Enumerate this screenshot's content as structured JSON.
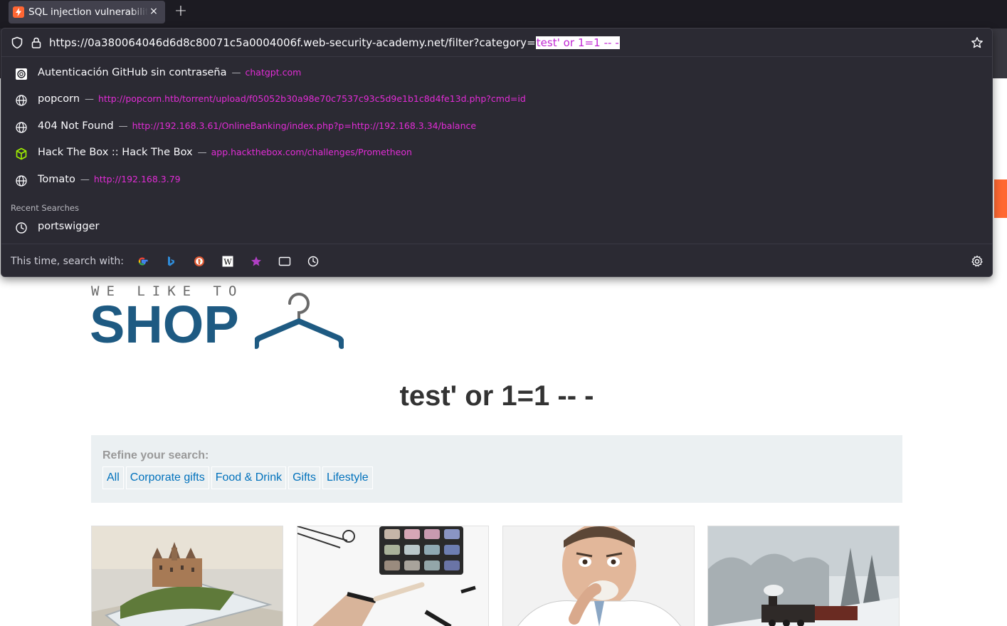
{
  "browser": {
    "tab": {
      "title": "SQL injection vulnerability in WHERE clause allowing retrieval of hidden data",
      "favicon": "portswigger-icon",
      "close_label": "×"
    },
    "new_tab_label": "+",
    "url": {
      "base": "https://0a380064046d6d8c80071c5a0004006f.web-security-academy.net/filter?category=",
      "selected": "test' or 1=1 -- -"
    },
    "suggestions": [
      {
        "title": "Autenticación GitHub sin contraseña",
        "sep": "—",
        "url": "chatgpt.com",
        "icon": "chatgpt-icon"
      },
      {
        "title": "popcorn",
        "sep": "—",
        "url": "http://popcorn.htb/torrent/upload/f05052b30a98e70c7537c93c5d9e1b1c8d4fe13d.php?cmd=id",
        "icon": "globe-icon"
      },
      {
        "title": "404 Not Found",
        "sep": "—",
        "url": "http://192.168.3.61/OnlineBanking/index.php?p=http://192.168.3.34/balance",
        "icon": "globe-icon"
      },
      {
        "title": "Hack The Box :: Hack The Box",
        "sep": "—",
        "url": "app.hackthebox.com/challenges/Prometheon",
        "icon": "hackthebox-icon"
      },
      {
        "title": "Tomato",
        "sep": "—",
        "url": "http://192.168.3.79",
        "icon": "globe-icon"
      }
    ],
    "recent_label": "Recent Searches",
    "recent": [
      {
        "title": "portswigger",
        "icon": "clock-icon"
      }
    ],
    "search_with_label": "This time, search with:",
    "engines": [
      "google-icon",
      "bing-icon",
      "duckduckgo-icon",
      "wikipedia-icon",
      "bookmarks-icon",
      "tabs-icon",
      "history-icon"
    ]
  },
  "page": {
    "logo": {
      "tagline": "WE LIKE TO",
      "name": "SHOP"
    },
    "heading": "test' or 1=1 -- -",
    "filter": {
      "label": "Refine your search:",
      "categories": [
        "All",
        "Corporate gifts",
        "Food & Drink",
        "Gifts",
        "Lifestyle"
      ]
    },
    "products": [
      "castle-phone-image",
      "makeup-image",
      "man-eating-image",
      "winter-train-image"
    ]
  },
  "colors": {
    "chrome_bg": "#1c1b22",
    "panel_bg": "#2b2a33",
    "url_highlight": "#e22cd6",
    "brand_blue": "#1e5a82",
    "link_blue": "#0071bc",
    "filter_bg": "#ebf0f2",
    "accent_orange": "#ff6832"
  }
}
